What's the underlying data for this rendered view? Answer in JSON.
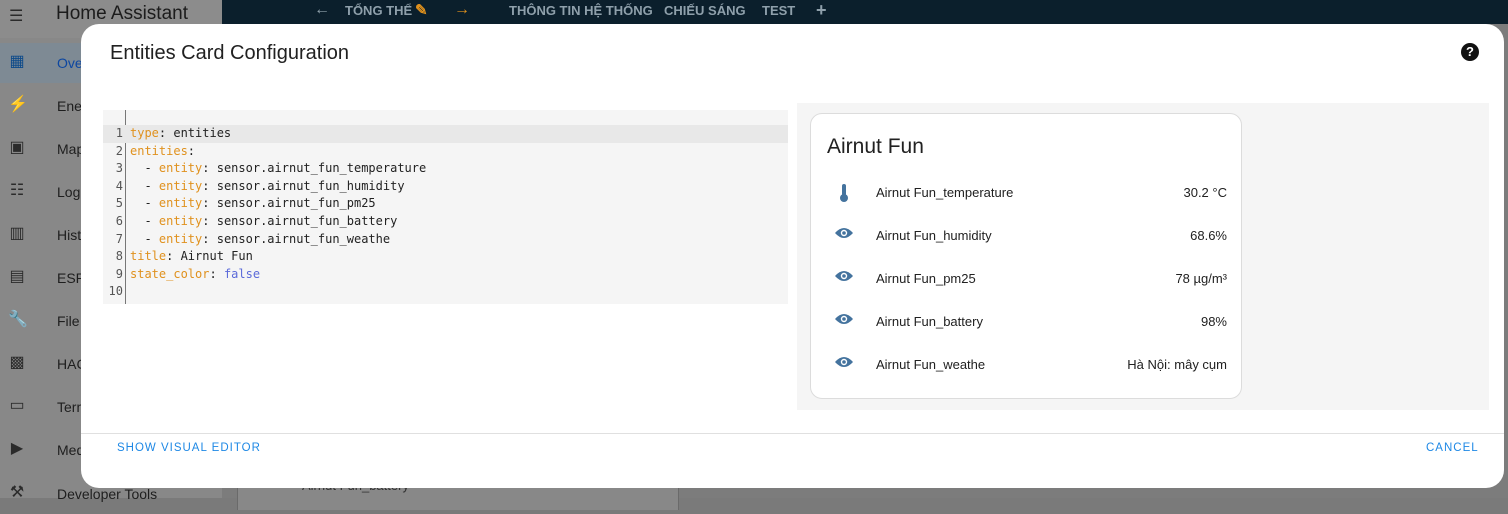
{
  "app": {
    "title": "Home Assistant"
  },
  "sidebar": {
    "items": [
      {
        "label": "Overview",
        "icon": "dashboard-icon",
        "active": true
      },
      {
        "label": "Energy",
        "icon": "lightning-icon"
      },
      {
        "label": "Map",
        "icon": "map-icon"
      },
      {
        "label": "Logbook",
        "icon": "list-icon"
      },
      {
        "label": "History",
        "icon": "chart-icon"
      },
      {
        "label": "ESPHome",
        "icon": "chip-icon"
      },
      {
        "label": "File editor",
        "icon": "wrench-icon"
      },
      {
        "label": "HACS",
        "icon": "hacs-icon"
      },
      {
        "label": "Terminal",
        "icon": "terminal-icon"
      },
      {
        "label": "Media",
        "icon": "media-icon"
      },
      {
        "label": "Developer Tools",
        "icon": "hammer-icon"
      }
    ]
  },
  "topbar": {
    "tabs": [
      "TỔNG THỂ",
      "THÔNG TIN HỆ THỐNG",
      "CHIẾU SÁNG",
      "TEST"
    ]
  },
  "background_card": {
    "row_label": "Airnut Fun_battery"
  },
  "dialog": {
    "title": "Entities Card Configuration",
    "help_icon": "help-circle-icon",
    "editor_lines": [
      {
        "n": "1",
        "key": "type",
        "sep": ": ",
        "val": "entities"
      },
      {
        "n": "2",
        "key": "entities",
        "sep": ":",
        "val": ""
      },
      {
        "n": "3",
        "indent": "  - ",
        "key": "entity",
        "sep": ": ",
        "val": "sensor.airnut_fun_temperature"
      },
      {
        "n": "4",
        "indent": "  - ",
        "key": "entity",
        "sep": ": ",
        "val": "sensor.airnut_fun_humidity"
      },
      {
        "n": "5",
        "indent": "  - ",
        "key": "entity",
        "sep": ": ",
        "val": "sensor.airnut_fun_pm25"
      },
      {
        "n": "6",
        "indent": "  - ",
        "key": "entity",
        "sep": ": ",
        "val": "sensor.airnut_fun_battery"
      },
      {
        "n": "7",
        "indent": "  - ",
        "key": "entity",
        "sep": ": ",
        "val": "sensor.airnut_fun_weathe"
      },
      {
        "n": "8",
        "key": "title",
        "sep": ": ",
        "val": "Airnut Fun"
      },
      {
        "n": "9",
        "key": "state_color",
        "sep": ": ",
        "bool": "false"
      },
      {
        "n": "10",
        "key": "",
        "sep": "",
        "val": ""
      }
    ],
    "preview": {
      "title": "Airnut Fun",
      "rows": [
        {
          "name": "Airnut Fun_temperature",
          "value": "30.2 °C",
          "icon": "thermometer-icon"
        },
        {
          "name": "Airnut Fun_humidity",
          "value": "68.6%",
          "icon": "eye-icon"
        },
        {
          "name": "Airnut Fun_pm25",
          "value": "78 µg/m³",
          "icon": "eye-icon"
        },
        {
          "name": "Airnut Fun_battery",
          "value": "98%",
          "icon": "eye-icon"
        },
        {
          "name": "Airnut Fun_weathe",
          "value": "Hà Nội: mây cụm",
          "icon": "eye-icon"
        }
      ]
    },
    "show_visual_editor": "SHOW VISUAL EDITOR",
    "cancel": "CANCEL"
  },
  "colors": {
    "accent": "#1e88e5",
    "yaml_key": "#e0911d",
    "icon": "#44739e"
  }
}
